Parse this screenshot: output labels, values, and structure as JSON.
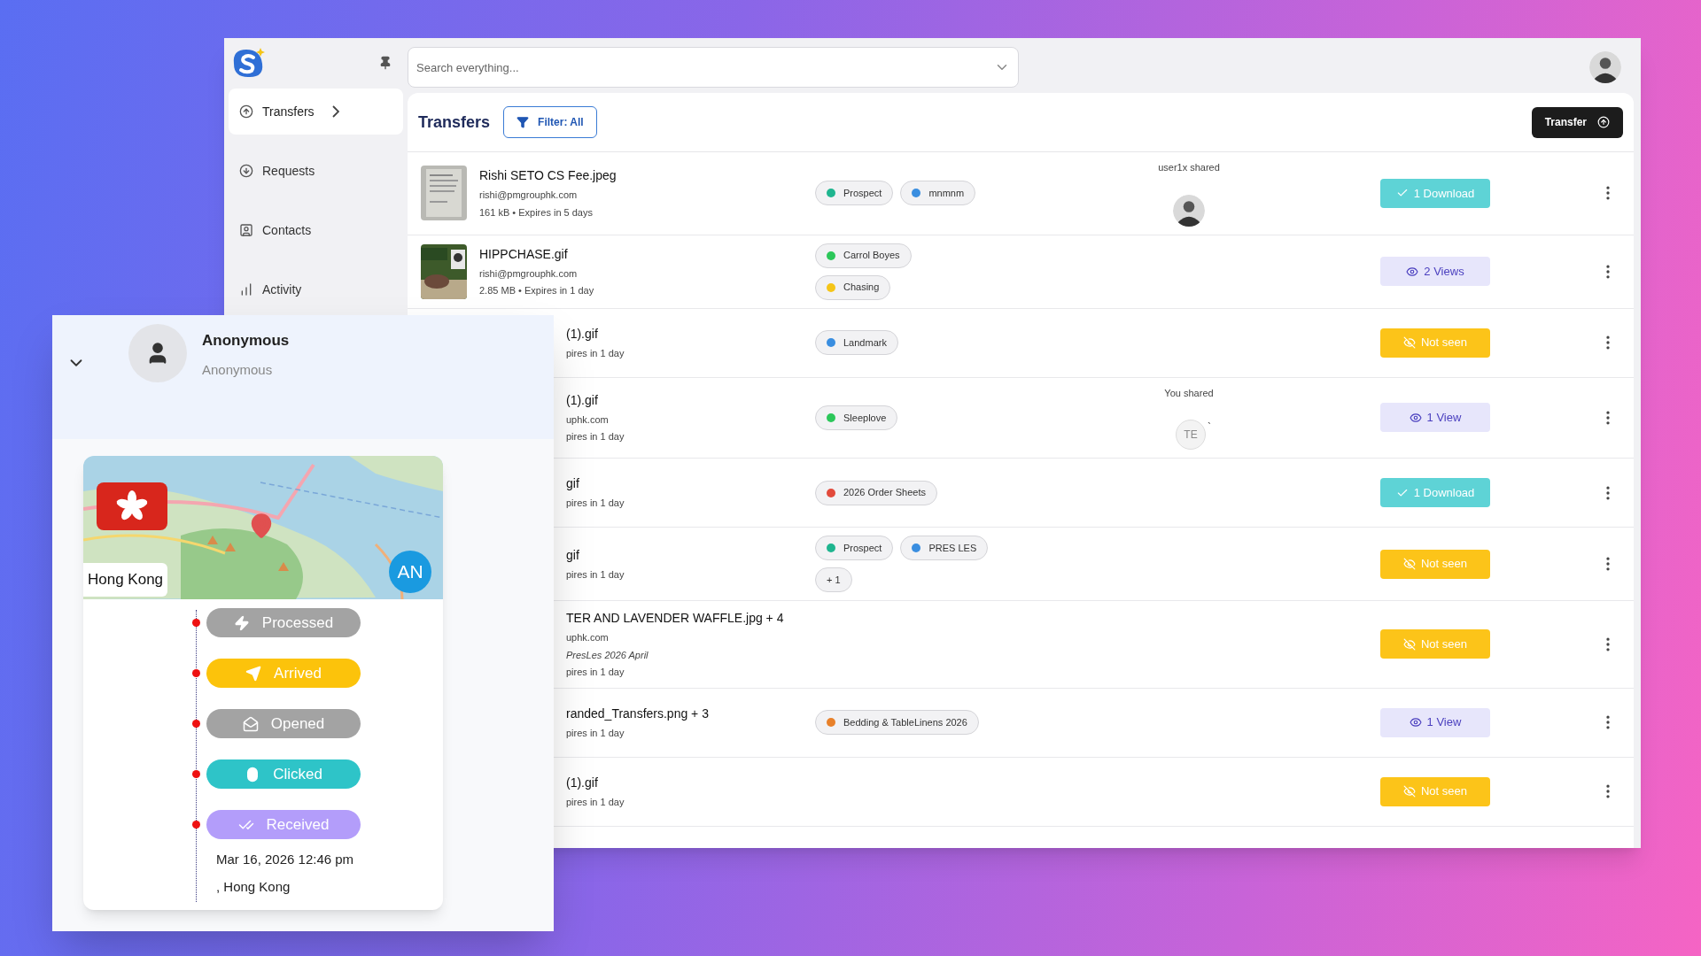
{
  "sidebar": {
    "items": [
      {
        "label": "Transfers",
        "selected": true
      },
      {
        "label": "Requests",
        "selected": false
      },
      {
        "label": "Contacts",
        "selected": false
      },
      {
        "label": "Activity",
        "selected": false
      }
    ]
  },
  "search": {
    "placeholder": "Search everything..."
  },
  "header": {
    "title": "Transfers",
    "filter_button": "Filter: All",
    "transfer_button": "Transfer"
  },
  "rows": [
    {
      "thumbnail": true,
      "name": "Rishi SETO CS Fee.jpeg",
      "email": "rishi@pmgrouphk.com",
      "meta": "161 kB • Expires in 5 days",
      "tag_lines": [
        [
          {
            "label": "Prospect",
            "color": "#1fb58f"
          },
          {
            "label": "mnmnm",
            "color": "#3a8ee0"
          }
        ]
      ],
      "shared": {
        "label": "user1x shared"
      },
      "status": {
        "kind": "download",
        "label": "1 Download"
      }
    },
    {
      "thumbnail": true,
      "name": "HIPPCHASE.gif",
      "email": "rishi@pmgrouphk.com",
      "meta": "2.85 MB • Expires in 1 day",
      "tag_lines": [
        [
          {
            "label": "Carrol Boyes",
            "color": "#2cc75a"
          }
        ],
        [
          {
            "label": "Chasing",
            "color": "#f5c518"
          }
        ]
      ],
      "status": {
        "kind": "views",
        "label": "2 Views"
      }
    },
    {
      "thumbnail": false,
      "name": "(1).gif",
      "meta": "pires in 1 day",
      "tag_lines": [
        [
          {
            "label": "Landmark",
            "color": "#3a8ee0"
          }
        ]
      ],
      "status": {
        "kind": "not_seen",
        "label": "Not seen"
      }
    },
    {
      "thumbnail": false,
      "name": "(1).gif",
      "email": "uphk.com",
      "meta": "pires in 1 day",
      "tag_lines": [
        [
          {
            "label": "Sleeplove",
            "color": "#2cc75a"
          }
        ]
      ],
      "shared": {
        "kind": "initials",
        "label": "You shared",
        "initials": "TE",
        "mark": "`"
      },
      "status": {
        "kind": "views",
        "label": "1 View"
      }
    },
    {
      "thumbnail": false,
      "name": "gif",
      "meta": "pires in 1 day",
      "tag_lines": [
        [
          {
            "label": "2026 Order Sheets",
            "color": "#e24a3b"
          }
        ]
      ],
      "status": {
        "kind": "download",
        "label": "1 Download"
      }
    },
    {
      "thumbnail": false,
      "name": "gif",
      "meta": "pires in 1 day",
      "tag_lines": [
        [
          {
            "label": "Prospect",
            "color": "#1fb58f"
          },
          {
            "label": "PRES LES",
            "color": "#3a8ee0"
          }
        ],
        [
          {
            "label": "+ 1"
          }
        ]
      ],
      "status": {
        "kind": "not_seen",
        "label": "Not seen"
      }
    },
    {
      "thumbnail": false,
      "name": "TER AND LAVENDER WAFFLE.jpg + 4",
      "email": "uphk.com",
      "note": "PresLes 2026 April",
      "meta": "pires in 1 day",
      "tag_lines": [],
      "status": {
        "kind": "not_seen",
        "label": "Not seen"
      }
    },
    {
      "thumbnail": false,
      "name": "randed_Transfers.png + 3",
      "meta": "pires in 1 day",
      "tag_lines": [
        [
          {
            "label": "Bedding & TableLinens 2026",
            "color": "#e8812a"
          }
        ]
      ],
      "status": {
        "kind": "views",
        "label": "1 View"
      }
    },
    {
      "thumbnail": false,
      "name": "(1).gif",
      "meta": "pires in 1 day",
      "tag_lines": [],
      "status": {
        "kind": "not_seen",
        "label": "Not seen"
      }
    }
  ],
  "contact_panel": {
    "name": "Anonymous",
    "subtitle": "Anonymous",
    "location_label": "Hong Kong",
    "initials": "AN",
    "timeline": [
      {
        "kind": "processed",
        "label": "Processed",
        "color": "#a3a3a3"
      },
      {
        "kind": "arrived",
        "label": "Arrived",
        "color": "#fcc30b"
      },
      {
        "kind": "opened",
        "label": "Opened",
        "color": "#a3a3a3"
      },
      {
        "kind": "clicked",
        "label": "Clicked",
        "color": "#2ec4c8"
      },
      {
        "kind": "received",
        "label": "Received",
        "color": "#b39dfa"
      }
    ],
    "timestamp": "Mar 16, 2026 12:46 pm",
    "place": ", Hong Kong"
  }
}
